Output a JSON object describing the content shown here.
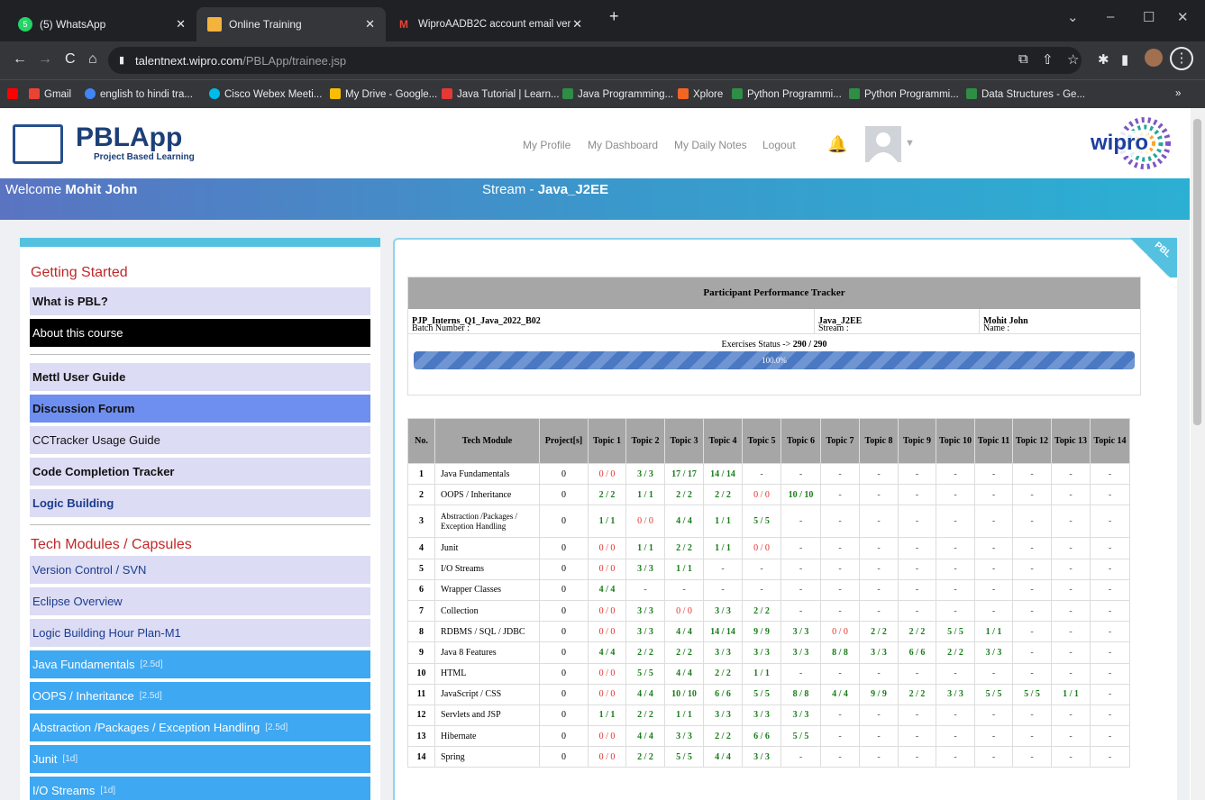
{
  "tabs": [
    {
      "title": "(5) WhatsApp",
      "color": "#25d366",
      "badge": "5"
    },
    {
      "title": "Online Training",
      "color": "#f3b33d",
      "badge": ""
    },
    {
      "title": "WiproAADB2C account email ver",
      "color": "#ea4335",
      "badge": "M"
    }
  ],
  "window_controls": [
    "⌄",
    "–",
    "☐",
    "✕"
  ],
  "url": {
    "host": "talentnext.wipro.com",
    "path": "/PBLApp/trainee.jsp"
  },
  "bookmarks": [
    {
      "label": "",
      "color": "#ff0000"
    },
    {
      "label": "Gmail",
      "color": "#ea4335"
    },
    {
      "label": "english to hindi tra...",
      "color": "#4285f4"
    },
    {
      "label": "Cisco Webex Meeti...",
      "color": "#00bceb"
    },
    {
      "label": "My Drive - Google...",
      "color": "#fbbc04"
    },
    {
      "label": "Java Tutorial | Learn...",
      "color": "#e53935"
    },
    {
      "label": "Java Programming...",
      "color": "#2f8d46"
    },
    {
      "label": "Xplore",
      "color": "#f26522"
    },
    {
      "label": "Python Programmi...",
      "color": "#2f8d46"
    },
    {
      "label": "Python Programmi...",
      "color": "#2f8d46"
    },
    {
      "label": "Data Structures - Ge...",
      "color": "#2f8d46"
    }
  ],
  "app": {
    "logo": "PBLApp",
    "logo_sub": "Project Based Learning",
    "brand": "wipro"
  },
  "nav": [
    "My Profile",
    "My Dashboard",
    "My Daily Notes",
    "Logout"
  ],
  "welcome": {
    "prefix": "Welcome ",
    "name": "Mohit John"
  },
  "stream": {
    "prefix": "Stream - ",
    "name": "Java_J2EE"
  },
  "sidebar": {
    "getting_started": "Getting Started",
    "items_a": [
      {
        "label": "What is PBL?",
        "bg": "#dcdcf5",
        "color": "#111",
        "bold": true
      },
      {
        "label": "About this course",
        "bg": "#000000",
        "color": "#fff",
        "bold": false
      }
    ],
    "items_b": [
      {
        "label": "Mettl User Guide",
        "bg": "#dcdcf5",
        "color": "#111",
        "bold": true
      },
      {
        "label": "Discussion Forum",
        "bg": "#6e8ff0",
        "color": "#111",
        "bold": true
      },
      {
        "label": "CCTracker Usage Guide",
        "bg": "#dcdcf5",
        "color": "#111",
        "bold": false
      },
      {
        "label": "Code Completion Tracker",
        "bg": "#dcdcf5",
        "color": "#111",
        "bold": true
      },
      {
        "label": "Logic Building",
        "bg": "#dcdcf5",
        "color": "#1c3c8c",
        "bold": true
      }
    ],
    "tech_title": "Tech Modules / Capsules",
    "items_c": [
      {
        "label": "Version Control / SVN",
        "bg": "#dcdcf5",
        "color": "#1c3c8c",
        "dur": ""
      },
      {
        "label": "Eclipse Overview",
        "bg": "#dcdcf5",
        "color": "#1c3c8c",
        "dur": ""
      },
      {
        "label": "Logic Building Hour Plan-M1",
        "bg": "#dcdcf5",
        "color": "#1c3c8c",
        "dur": ""
      },
      {
        "label": "Java Fundamentals",
        "bg": "#3ea8f2",
        "color": "#fff",
        "dur": "[2.5d]"
      },
      {
        "label": "OOPS / Inheritance",
        "bg": "#3ea8f2",
        "color": "#fff",
        "dur": "[2.5d]"
      },
      {
        "label": "Abstraction /Packages / Exception Handling",
        "bg": "#3ea8f2",
        "color": "#fff",
        "dur": "[2.5d]"
      },
      {
        "label": "Junit",
        "bg": "#3ea8f2",
        "color": "#fff",
        "dur": "[1d]"
      },
      {
        "label": "I/O Streams",
        "bg": "#3ea8f2",
        "color": "#fff",
        "dur": "[1d]"
      }
    ]
  },
  "tracker": {
    "title": "Participant Performance Tracker",
    "batch_label": "Batch Number : ",
    "batch": "PJP_Interns_Q1_Java_2022_B02",
    "stream_label": "Stream : ",
    "stream": "Java_J2EE",
    "name_label": "Name : ",
    "name": "Mohit John",
    "exercise_label": "Exercises Status -> ",
    "exercise": "290 / 290",
    "progress_pct": 100,
    "progress_label": "100.0%"
  },
  "table": {
    "headers": [
      "No.",
      "Tech Module",
      "Project[s]",
      "Topic 1",
      "Topic 2",
      "Topic 3",
      "Topic 4",
      "Topic 5",
      "Topic 6",
      "Topic 7",
      "Topic 8",
      "Topic 9",
      "Topic 10",
      "Topic 11",
      "Topic 12",
      "Topic 13",
      "Topic 14"
    ],
    "rows": [
      [
        "1",
        "Java Fundamentals",
        "0",
        "0 / 0",
        "3 / 3",
        "17 / 17",
        "14 / 14",
        "-",
        "-",
        "-",
        "-",
        "-",
        "-",
        "-",
        "-",
        "-",
        "-"
      ],
      [
        "2",
        "OOPS / Inheritance",
        "0",
        "2 / 2",
        "1 / 1",
        "2 / 2",
        "2 / 2",
        "0 / 0",
        "10 / 10",
        "-",
        "-",
        "-",
        "-",
        "-",
        "-",
        "-",
        "-"
      ],
      [
        "3",
        "Abstraction /Packages / Exception Handling",
        "0",
        "1 / 1",
        "0 / 0",
        "4 / 4",
        "1 / 1",
        "5 / 5",
        "-",
        "-",
        "-",
        "-",
        "-",
        "-",
        "-",
        "-",
        "-"
      ],
      [
        "4",
        "Junit",
        "0",
        "0 / 0",
        "1 / 1",
        "2 / 2",
        "1 / 1",
        "0 / 0",
        "-",
        "-",
        "-",
        "-",
        "-",
        "-",
        "-",
        "-",
        "-"
      ],
      [
        "5",
        "I/O Streams",
        "0",
        "0 / 0",
        "3 / 3",
        "1 / 1",
        "-",
        "-",
        "-",
        "-",
        "-",
        "-",
        "-",
        "-",
        "-",
        "-",
        "-"
      ],
      [
        "6",
        "Wrapper Classes",
        "0",
        "4 / 4",
        "-",
        "-",
        "-",
        "-",
        "-",
        "-",
        "-",
        "-",
        "-",
        "-",
        "-",
        "-",
        "-"
      ],
      [
        "7",
        "Collection",
        "0",
        "0 / 0",
        "3 / 3",
        "0 / 0",
        "3 / 3",
        "2 / 2",
        "-",
        "-",
        "-",
        "-",
        "-",
        "-",
        "-",
        "-",
        "-"
      ],
      [
        "8",
        "RDBMS / SQL / JDBC",
        "0",
        "0 / 0",
        "3 / 3",
        "4 / 4",
        "14 / 14",
        "9 / 9",
        "3 / 3",
        "0 / 0",
        "2 / 2",
        "2 / 2",
        "5 / 5",
        "1 / 1",
        "-",
        "-",
        "-"
      ],
      [
        "9",
        "Java 8 Features",
        "0",
        "4 / 4",
        "2 / 2",
        "2 / 2",
        "3 / 3",
        "3 / 3",
        "3 / 3",
        "8 / 8",
        "3 / 3",
        "6 / 6",
        "2 / 2",
        "3 / 3",
        "-",
        "-",
        "-"
      ],
      [
        "10",
        "HTML",
        "0",
        "0 / 0",
        "5 / 5",
        "4 / 4",
        "2 / 2",
        "1 / 1",
        "-",
        "-",
        "-",
        "-",
        "-",
        "-",
        "-",
        "-",
        "-"
      ],
      [
        "11",
        "JavaScript / CSS",
        "0",
        "0 / 0",
        "4 / 4",
        "10 / 10",
        "6 / 6",
        "5 / 5",
        "8 / 8",
        "4 / 4",
        "9 / 9",
        "2 / 2",
        "3 / 3",
        "5 / 5",
        "5 / 5",
        "1 / 1",
        "-"
      ],
      [
        "12",
        "Servlets and JSP",
        "0",
        "1 / 1",
        "2 / 2",
        "1 / 1",
        "3 / 3",
        "3 / 3",
        "3 / 3",
        "-",
        "-",
        "-",
        "-",
        "-",
        "-",
        "-",
        "-"
      ],
      [
        "13",
        "Hibernate",
        "0",
        "0 / 0",
        "4 / 4",
        "3 / 3",
        "2 / 2",
        "6 / 6",
        "5 / 5",
        "-",
        "-",
        "-",
        "-",
        "-",
        "-",
        "-",
        "-"
      ],
      [
        "14",
        "Spring",
        "0",
        "0 / 0",
        "2 / 2",
        "5 / 5",
        "4 / 4",
        "3 / 3",
        "-",
        "-",
        "-",
        "-",
        "-",
        "-",
        "-",
        "-",
        "-"
      ]
    ]
  }
}
